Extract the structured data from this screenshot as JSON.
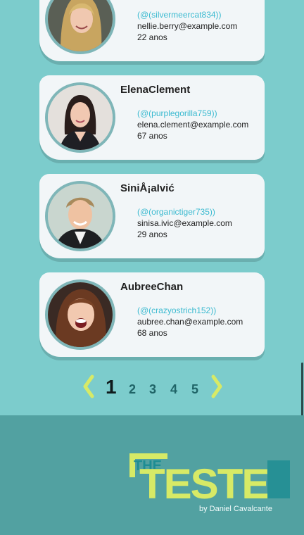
{
  "users": [
    {
      "name": "",
      "handle": "(@(silvermeercat834))",
      "email": "nellie.berry@example.com",
      "age": "22 anos",
      "photo": "woman-blonde"
    },
    {
      "name": "ElenaClement",
      "handle": "(@(purplegorilla759))",
      "email": "elena.clement@example.com",
      "age": "67 anos",
      "photo": "woman-dark-hair"
    },
    {
      "name": "SiniÅ¡aIvić",
      "handle": "(@(organictiger735))",
      "email": "sinisa.ivic@example.com",
      "age": "29 anos",
      "photo": "man-short-hair"
    },
    {
      "name": "AubreeChan",
      "handle": "(@(crazyostrich152))",
      "email": "aubree.chan@example.com",
      "age": "68 anos",
      "photo": "woman-brown-hair"
    }
  ],
  "pagination": {
    "prev_icon": "chevron-left-icon",
    "next_icon": "chevron-right-icon",
    "pages": [
      "1",
      "2",
      "3",
      "4",
      "5"
    ],
    "current": "1"
  },
  "footer": {
    "logo_small": "THE",
    "logo_big": "TESTE",
    "byline": "by Daniel Cavalcante"
  },
  "colors": {
    "background": "#7ccccc",
    "footer": "#52a1a1",
    "accent_yellow": "#dde86a",
    "accent_teal": "#1e8d93",
    "handle": "#3bbad0"
  }
}
